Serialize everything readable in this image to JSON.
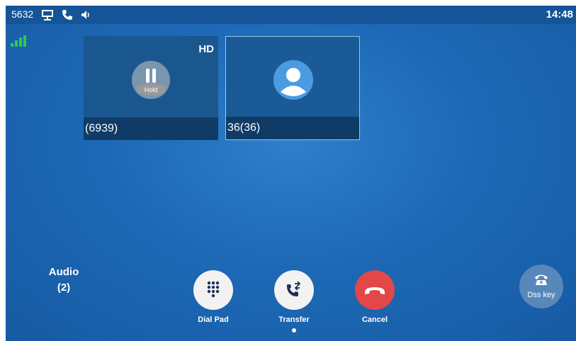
{
  "statusbar": {
    "extension": "5632",
    "time": "14:48",
    "icons": [
      "network-icon",
      "phone-icon",
      "speaker-icon"
    ]
  },
  "signal_icon": "signal-bars-icon",
  "calls": [
    {
      "name": "(6939)",
      "hd_badge": "HD",
      "avatar_icon": "hold-icon",
      "avatar_label": "Hold",
      "state": "held"
    },
    {
      "name": "36(36)",
      "avatar_icon": "user-avatar-icon",
      "state": "active",
      "selected": true
    }
  ],
  "audio": {
    "label": "Audio",
    "count": "(2)"
  },
  "actions": [
    {
      "label": "Dial Pad",
      "icon": "dialpad-icon",
      "color": "#f2f2f2"
    },
    {
      "label": "Transfer",
      "icon": "transfer-icon",
      "color": "#f2f2f2"
    },
    {
      "label": "Cancel",
      "icon": "hangup-icon",
      "color": "#e34747"
    }
  ],
  "dss_key": {
    "label": "Dss key",
    "icon": "telephone-icon"
  },
  "colors": {
    "statusbar": "#155496",
    "background": "#1d69b6",
    "signal": "#2ecc40",
    "hangup": "#e34747"
  }
}
